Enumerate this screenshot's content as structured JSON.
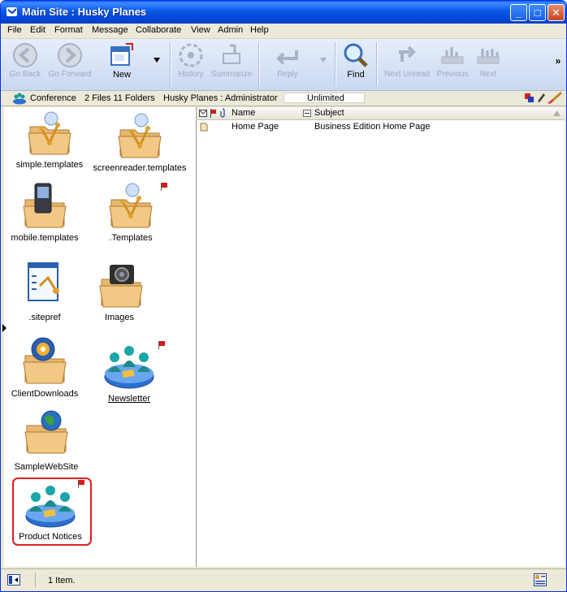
{
  "window": {
    "title": "Main Site : Husky Planes",
    "controls": [
      "_",
      "□",
      "✕"
    ]
  },
  "menu": [
    "File",
    "Edit",
    "Format",
    "Message",
    "Collaborate",
    "View",
    "Admin",
    "Help"
  ],
  "toolbar": {
    "go_back": "Go Back",
    "go_forward": "Go Forward",
    "new": "New",
    "history": "History",
    "summarize": "Summarize",
    "reply": "Reply",
    "find": "Find",
    "next_unread": "Next Unread",
    "previous": "Previous",
    "next": "Next",
    "overflow": "»"
  },
  "infobar": {
    "conference": "Conference",
    "counts": "2 Files 11 Folders",
    "location": "Husky Planes : Administrator",
    "quota": "Unlimited"
  },
  "folders": [
    {
      "label": "simple.templates",
      "flagged": false
    },
    {
      "label": "screenreader.templates",
      "flagged": false
    },
    {
      "label": "mobile.templates",
      "flagged": false
    },
    {
      "label": ".Templates",
      "flagged": true
    },
    {
      "label": ".sitepref",
      "flagged": false
    },
    {
      "label": "Images",
      "flagged": false
    },
    {
      "label": "ClientDownloads",
      "flagged": false
    },
    {
      "label": "Newsletter",
      "flagged": true
    },
    {
      "label": "SampleWebSite",
      "flagged": false
    },
    {
      "label": "Product Notices",
      "flagged": true
    }
  ],
  "list": {
    "columns": {
      "name": "Name",
      "subject": "Subject"
    },
    "rows": [
      {
        "name": "Home Page",
        "subject": "Business Edition Home Page"
      }
    ]
  },
  "status": {
    "text": "1 Item."
  }
}
